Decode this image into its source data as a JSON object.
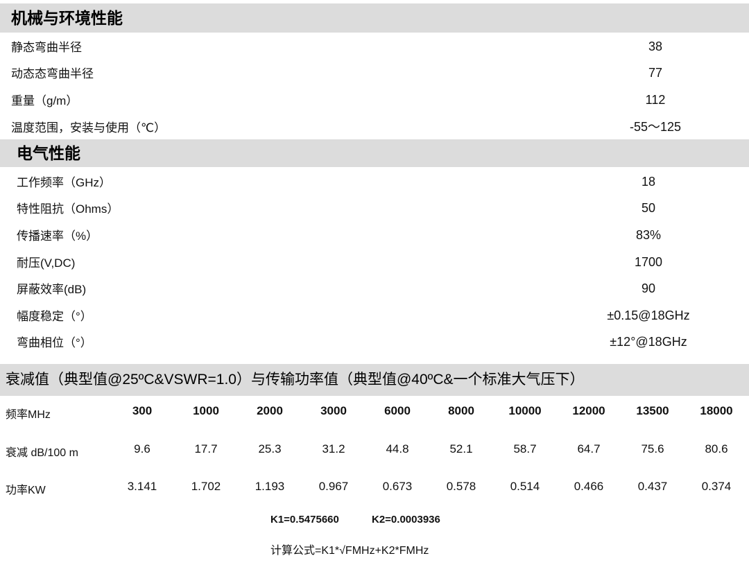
{
  "mechanical": {
    "title": "机械与环境性能",
    "rows": [
      {
        "label": "静态弯曲半径",
        "value": "38"
      },
      {
        "label": "动态态弯曲半径",
        "value": "77"
      },
      {
        "label": "重量（g/m）",
        "value": "112"
      },
      {
        "label": "温度范围，安装与使用（℃）",
        "value": "-55～125"
      }
    ]
  },
  "electrical": {
    "title": "电气性能",
    "rows": [
      {
        "label": "工作频率（GHz）",
        "value": "18"
      },
      {
        "label": "特性阻抗（Ohms）",
        "value": "50"
      },
      {
        "label": "传播速率（%）",
        "value": "83%"
      },
      {
        "label": "耐压(V,DC)",
        "value": "1700"
      },
      {
        "label": "屏蔽效率(dB)",
        "value": "90"
      },
      {
        "label": "幅度稳定（°）",
        "value": "±0.15@18GHz"
      },
      {
        "label": "弯曲相位（°）",
        "value": "±12°@18GHz"
      }
    ]
  },
  "attenuation": {
    "title": "衰减值（典型值@25ºC&VSWR=1.0）与传输功率值（典型值@40ºC&一个标准大气压下）",
    "freq_label": "频率MHz",
    "freqs": [
      "300",
      "1000",
      "2000",
      "3000",
      "6000",
      "8000",
      "10000",
      "12000",
      "13500",
      "18000"
    ],
    "atten_label": "衰减 dB/100 m",
    "atten": [
      "9.6",
      "17.7",
      "25.3",
      "31.2",
      "44.8",
      "52.1",
      "58.7",
      "64.7",
      "75.6",
      "80.6"
    ],
    "power_label": "功率KW",
    "power": [
      "3.141",
      "1.702",
      "1.193",
      "0.967",
      "0.673",
      "0.578",
      "0.514",
      "0.466",
      "0.437",
      "0.374"
    ]
  },
  "constants": {
    "k1": "K1=0.5475660",
    "k2": "K2=0.0003936",
    "formula": "计算公式=K1*√FMHz+K2*FMHz"
  }
}
